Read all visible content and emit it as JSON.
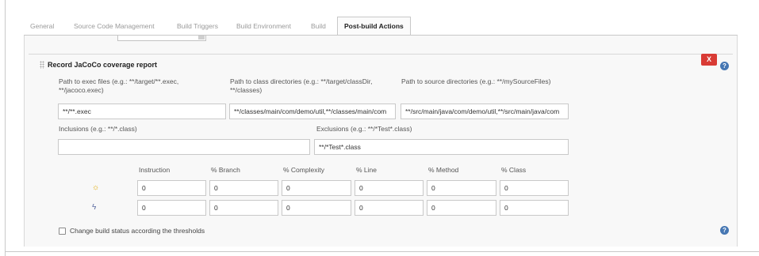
{
  "tabs": [
    {
      "label": "General"
    },
    {
      "label": "Source Code Management"
    },
    {
      "label": "Build Triggers"
    },
    {
      "label": "Build Environment"
    },
    {
      "label": "Build"
    },
    {
      "label": "Post-build Actions"
    }
  ],
  "section": {
    "title": "Record JaCoCo coverage report",
    "delete_label": "X",
    "help_glyph": "?"
  },
  "fields": {
    "exec_label": "Path to exec files (e.g.: **/target/**.exec, **/jacoco.exec)",
    "exec_value": "**/**.exec",
    "class_label": "Path to class directories (e.g.: **/target/classDir, **/classes)",
    "class_value": "**/classes/main/com/demo/util,**/classes/main/com",
    "source_label": "Path to source directories (e.g.: **/mySourceFiles)",
    "source_value": "**/src/main/java/com/demo/util,**/src/main/java/com",
    "inclusions_label": "Inclusions (e.g.: **/*.class)",
    "inclusions_value": "",
    "exclusions_label": "Exclusions (e.g.: **/*Test*.class)",
    "exclusions_value": "**/*Test*.class"
  },
  "thresholds": {
    "columns": [
      "Instruction",
      "% Branch",
      "% Complexity",
      "% Line",
      "% Method",
      "% Class"
    ],
    "rows": [
      {
        "icon": "sun-icon",
        "glyph": "☼",
        "values": [
          "0",
          "0",
          "0",
          "0",
          "0",
          "0"
        ]
      },
      {
        "icon": "storm-icon",
        "glyph": "ϟ",
        "values": [
          "0",
          "0",
          "0",
          "0",
          "0",
          "0"
        ]
      }
    ]
  },
  "options": {
    "change_status_label": "Change build status according the thresholds",
    "change_status_checked": false
  },
  "colors": {
    "delete_button": "#d93b35",
    "help_icon": "#4677b3"
  }
}
